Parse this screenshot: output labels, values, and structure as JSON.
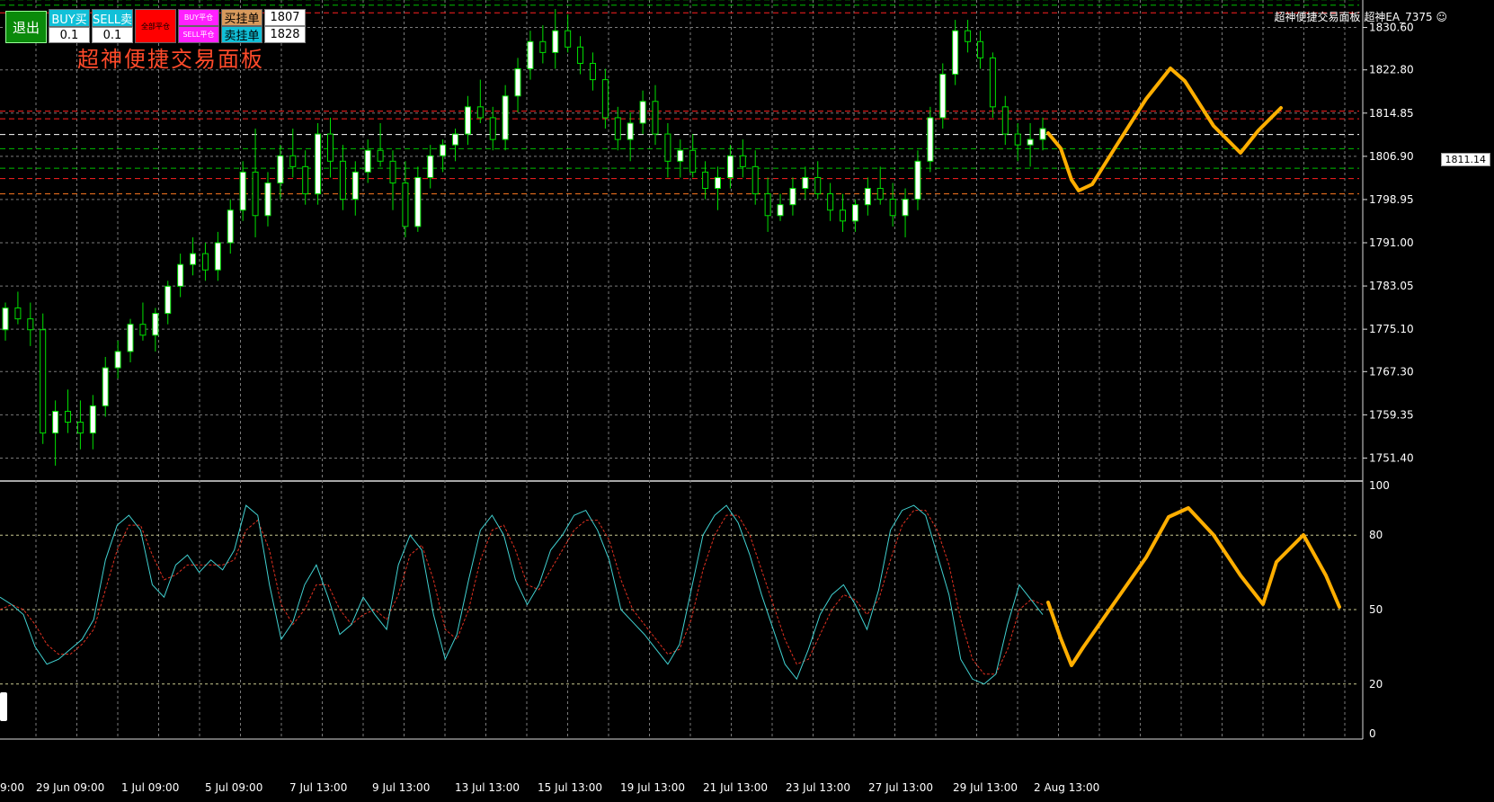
{
  "trade_panel": {
    "exit_label": "退出",
    "buy_label": "BUY买",
    "sell_label": "SELL卖",
    "close_all_label": "全部平仓",
    "buy_close_label": "BUY平仓",
    "sell_close_label": "SELL平仓",
    "buy_limit_label": "买挂单",
    "sell_limit_label": "卖挂单",
    "buy_lots_value": "0.1",
    "sell_lots_value": "0.1",
    "buy_limit_price": "1807",
    "sell_limit_price": "1828",
    "panel_title": "超神便捷交易面板"
  },
  "header": {
    "ea_label": "超神便捷交易面板  超神EA_7375 ☺"
  },
  "colors": {
    "bull_candle": "#00e000",
    "bull_body": "#ffffff",
    "grid": "#7a7a7a",
    "stoch_main": "#40d0d0",
    "stoch_signal": "#e03020",
    "annotation": "#ffae00",
    "exit_button": "#0a8a0a",
    "buy_button": "#11c0d8",
    "close_all_button": "#ff0000",
    "buy_close_button": "#ff20ff",
    "limit_button": "#d89a5c"
  },
  "price_chart": {
    "current_price": "1811.14",
    "axis_labels": [
      "1830.60",
      "1822.80",
      "1814.85",
      "1806.90",
      "1798.95",
      "1791.00",
      "1783.05",
      "1775.10",
      "1767.30",
      "1759.35",
      "1751.40"
    ],
    "ylim": [
      1748,
      1834
    ],
    "level_lines": [
      {
        "price": 1835.7,
        "color": "#00c000"
      },
      {
        "price": 1834.7,
        "color": "#00c000"
      },
      {
        "price": 1833.3,
        "color": "#ff2020"
      },
      {
        "price": 1815.2,
        "color": "#ff2020"
      },
      {
        "price": 1813.8,
        "color": "#ff2020"
      },
      {
        "price": 1810.9,
        "color": "#ffffff"
      },
      {
        "price": 1808.3,
        "color": "#00c000"
      },
      {
        "price": 1804.7,
        "color": "#00c000"
      },
      {
        "price": 1802.8,
        "color": "#ff2020"
      },
      {
        "price": 1800.0,
        "color": "#ff7a20"
      }
    ],
    "candles": [
      [
        1775,
        1780,
        1773,
        1779
      ],
      [
        1779,
        1782,
        1776,
        1777
      ],
      [
        1777,
        1780,
        1772,
        1775
      ],
      [
        1775,
        1778,
        1754,
        1756
      ],
      [
        1756,
        1762,
        1750,
        1760
      ],
      [
        1760,
        1764,
        1756,
        1758
      ],
      [
        1758,
        1762,
        1753,
        1756
      ],
      [
        1756,
        1763,
        1753,
        1761
      ],
      [
        1761,
        1770,
        1759,
        1768
      ],
      [
        1768,
        1773,
        1766,
        1771
      ],
      [
        1771,
        1777,
        1769,
        1776
      ],
      [
        1776,
        1780,
        1773,
        1774
      ],
      [
        1774,
        1779,
        1771,
        1778
      ],
      [
        1778,
        1784,
        1776,
        1783
      ],
      [
        1783,
        1789,
        1781,
        1787
      ],
      [
        1787,
        1792,
        1785,
        1789
      ],
      [
        1789,
        1791,
        1784,
        1786
      ],
      [
        1786,
        1793,
        1784,
        1791
      ],
      [
        1791,
        1799,
        1789,
        1797
      ],
      [
        1797,
        1806,
        1795,
        1804
      ],
      [
        1804,
        1812,
        1792,
        1796
      ],
      [
        1796,
        1804,
        1794,
        1802
      ],
      [
        1802,
        1809,
        1799,
        1807
      ],
      [
        1807,
        1812,
        1803,
        1805
      ],
      [
        1805,
        1808,
        1798,
        1800
      ],
      [
        1800,
        1813,
        1798,
        1811
      ],
      [
        1811,
        1814,
        1803,
        1806
      ],
      [
        1806,
        1809,
        1797,
        1799
      ],
      [
        1799,
        1806,
        1796,
        1804
      ],
      [
        1804,
        1810,
        1802,
        1808
      ],
      [
        1808,
        1813,
        1805,
        1806
      ],
      [
        1806,
        1808,
        1797,
        1802
      ],
      [
        1802,
        1806,
        1792,
        1794
      ],
      [
        1794,
        1805,
        1793,
        1803
      ],
      [
        1803,
        1809,
        1801,
        1807
      ],
      [
        1807,
        1810,
        1804,
        1809
      ],
      [
        1809,
        1812,
        1806,
        1811
      ],
      [
        1811,
        1818,
        1809,
        1816
      ],
      [
        1816,
        1821,
        1813,
        1814
      ],
      [
        1814,
        1816,
        1808,
        1810
      ],
      [
        1810,
        1820,
        1808,
        1818
      ],
      [
        1818,
        1825,
        1815,
        1823
      ],
      [
        1823,
        1830,
        1821,
        1828
      ],
      [
        1828,
        1831,
        1824,
        1826
      ],
      [
        1826,
        1834,
        1823,
        1830
      ],
      [
        1830,
        1833,
        1826,
        1827
      ],
      [
        1827,
        1829,
        1822,
        1824
      ],
      [
        1824,
        1826,
        1819,
        1821
      ],
      [
        1821,
        1823,
        1812,
        1814
      ],
      [
        1814,
        1816,
        1808,
        1810
      ],
      [
        1810,
        1815,
        1806,
        1813
      ],
      [
        1813,
        1819,
        1811,
        1817
      ],
      [
        1817,
        1820,
        1809,
        1811
      ],
      [
        1811,
        1813,
        1803,
        1806
      ],
      [
        1806,
        1810,
        1803,
        1808
      ],
      [
        1808,
        1811,
        1803,
        1804
      ],
      [
        1804,
        1806,
        1799,
        1801
      ],
      [
        1801,
        1805,
        1797,
        1803
      ],
      [
        1803,
        1809,
        1801,
        1807
      ],
      [
        1807,
        1810,
        1803,
        1805
      ],
      [
        1805,
        1808,
        1798,
        1800
      ],
      [
        1800,
        1803,
        1793,
        1796
      ],
      [
        1796,
        1800,
        1795,
        1798
      ],
      [
        1798,
        1803,
        1796,
        1801
      ],
      [
        1801,
        1805,
        1799,
        1803
      ],
      [
        1803,
        1806,
        1799,
        1800
      ],
      [
        1800,
        1802,
        1795,
        1797
      ],
      [
        1797,
        1800,
        1793,
        1795
      ],
      [
        1795,
        1799,
        1793,
        1798
      ],
      [
        1798,
        1803,
        1796,
        1801
      ],
      [
        1801,
        1805,
        1798,
        1799
      ],
      [
        1799,
        1802,
        1794,
        1796
      ],
      [
        1796,
        1801,
        1792,
        1799
      ],
      [
        1799,
        1808,
        1797,
        1806
      ],
      [
        1806,
        1816,
        1804,
        1814
      ],
      [
        1814,
        1824,
        1812,
        1822
      ],
      [
        1822,
        1832,
        1820,
        1830
      ],
      [
        1830,
        1832,
        1826,
        1828
      ],
      [
        1828,
        1830,
        1823,
        1825
      ],
      [
        1825,
        1826,
        1814,
        1816
      ],
      [
        1816,
        1818,
        1809,
        1811
      ],
      [
        1811,
        1813,
        1806,
        1809
      ],
      [
        1809,
        1813,
        1805,
        1810
      ],
      [
        1810,
        1814,
        1808,
        1812
      ]
    ],
    "annotation_points": [
      [
        1166,
        148
      ],
      [
        1180,
        165
      ],
      [
        1192,
        200
      ],
      [
        1200,
        212
      ],
      [
        1215,
        205
      ],
      [
        1240,
        165
      ],
      [
        1275,
        110
      ],
      [
        1302,
        76
      ],
      [
        1318,
        90
      ],
      [
        1350,
        140
      ],
      [
        1380,
        170
      ],
      [
        1400,
        145
      ],
      [
        1425,
        120
      ]
    ]
  },
  "stoch": {
    "levels": [
      "100",
      "80",
      "50",
      "20",
      "0"
    ],
    "ylim": [
      0,
      100
    ],
    "main": [
      55,
      52,
      48,
      35,
      28,
      30,
      34,
      38,
      46,
      70,
      84,
      88,
      82,
      60,
      55,
      68,
      72,
      65,
      70,
      66,
      74,
      92,
      88,
      60,
      38,
      45,
      60,
      68,
      55,
      40,
      44,
      55,
      48,
      42,
      68,
      80,
      74,
      48,
      30,
      40,
      62,
      82,
      88,
      80,
      62,
      52,
      60,
      74,
      80,
      88,
      90,
      82,
      70,
      50,
      45,
      40,
      34,
      28,
      36,
      58,
      80,
      88,
      92,
      85,
      72,
      56,
      42,
      28,
      22,
      34,
      48,
      56,
      60,
      52,
      42,
      58,
      82,
      90,
      92,
      88,
      72,
      56,
      30,
      22,
      20,
      24,
      44,
      60,
      54,
      48
    ],
    "signal": [
      50,
      52,
      50,
      44,
      36,
      32,
      32,
      36,
      42,
      58,
      74,
      84,
      84,
      72,
      62,
      64,
      68,
      68,
      68,
      68,
      70,
      82,
      86,
      74,
      52,
      44,
      50,
      60,
      60,
      50,
      44,
      48,
      50,
      46,
      56,
      72,
      76,
      62,
      42,
      38,
      50,
      70,
      82,
      84,
      74,
      60,
      58,
      66,
      74,
      82,
      86,
      86,
      78,
      62,
      50,
      44,
      38,
      32,
      34,
      46,
      66,
      80,
      88,
      88,
      80,
      66,
      52,
      38,
      28,
      30,
      40,
      50,
      56,
      54,
      48,
      54,
      70,
      84,
      90,
      90,
      82,
      68,
      46,
      30,
      24,
      24,
      34,
      50,
      54,
      52
    ],
    "annotation_points": [
      [
        1166,
        670
      ],
      [
        1180,
        710
      ],
      [
        1192,
        740
      ],
      [
        1205,
        720
      ],
      [
        1240,
        670
      ],
      [
        1275,
        620
      ],
      [
        1300,
        575
      ],
      [
        1322,
        565
      ],
      [
        1350,
        595
      ],
      [
        1380,
        640
      ],
      [
        1405,
        672
      ],
      [
        1420,
        625
      ],
      [
        1450,
        595
      ],
      [
        1475,
        640
      ],
      [
        1490,
        675
      ]
    ]
  },
  "time_axis": [
    "9:00",
    "29 Jun 09:00",
    "1 Jul 09:00",
    "5 Jul 09:00",
    "7 Jul 13:00",
    "9 Jul 13:00",
    "13 Jul 13:00",
    "15 Jul 13:00",
    "19 Jul 13:00",
    "21 Jul 13:00",
    "23 Jul 13:00",
    "27 Jul 13:00",
    "29 Jul 13:00",
    "2 Aug 13:00"
  ]
}
